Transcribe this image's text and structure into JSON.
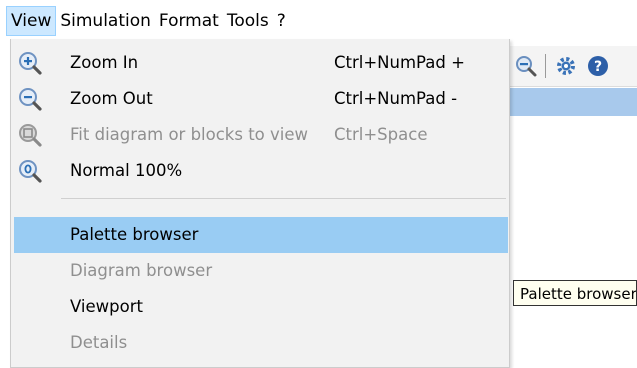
{
  "menubar": {
    "items": [
      {
        "label": "View",
        "active": true
      },
      {
        "label": "Simulation"
      },
      {
        "label": "Format"
      },
      {
        "label": "Tools"
      },
      {
        "label": "?"
      }
    ]
  },
  "view_menu": {
    "items": [
      {
        "label": "Zoom In",
        "shortcut": "Ctrl+NumPad +",
        "icon": "zoom-in-icon",
        "enabled": true
      },
      {
        "label": "Zoom Out",
        "shortcut": "Ctrl+NumPad -",
        "icon": "zoom-out-icon",
        "enabled": true
      },
      {
        "label": "Fit diagram or blocks to view",
        "shortcut": "Ctrl+Space",
        "icon": "zoom-fit-icon",
        "enabled": false
      },
      {
        "label": "Normal 100%",
        "shortcut": "",
        "icon": "zoom-normal-icon",
        "enabled": true
      },
      {
        "label": "Palette browser",
        "shortcut": "",
        "enabled": true,
        "highlighted": true
      },
      {
        "label": "Diagram browser",
        "shortcut": "",
        "enabled": false
      },
      {
        "label": "Viewport",
        "shortcut": "",
        "enabled": true
      },
      {
        "label": "Details",
        "shortcut": "",
        "enabled": false
      }
    ]
  },
  "tooltip": {
    "text": "Palette browser"
  },
  "colors": {
    "menu_bg": "#f2f2f2",
    "highlight": "#99ccf3",
    "disabled_text": "#8f8f8f",
    "toolbar_blue": "#a8c9ec",
    "icon_blue": "#2b6fb6"
  }
}
